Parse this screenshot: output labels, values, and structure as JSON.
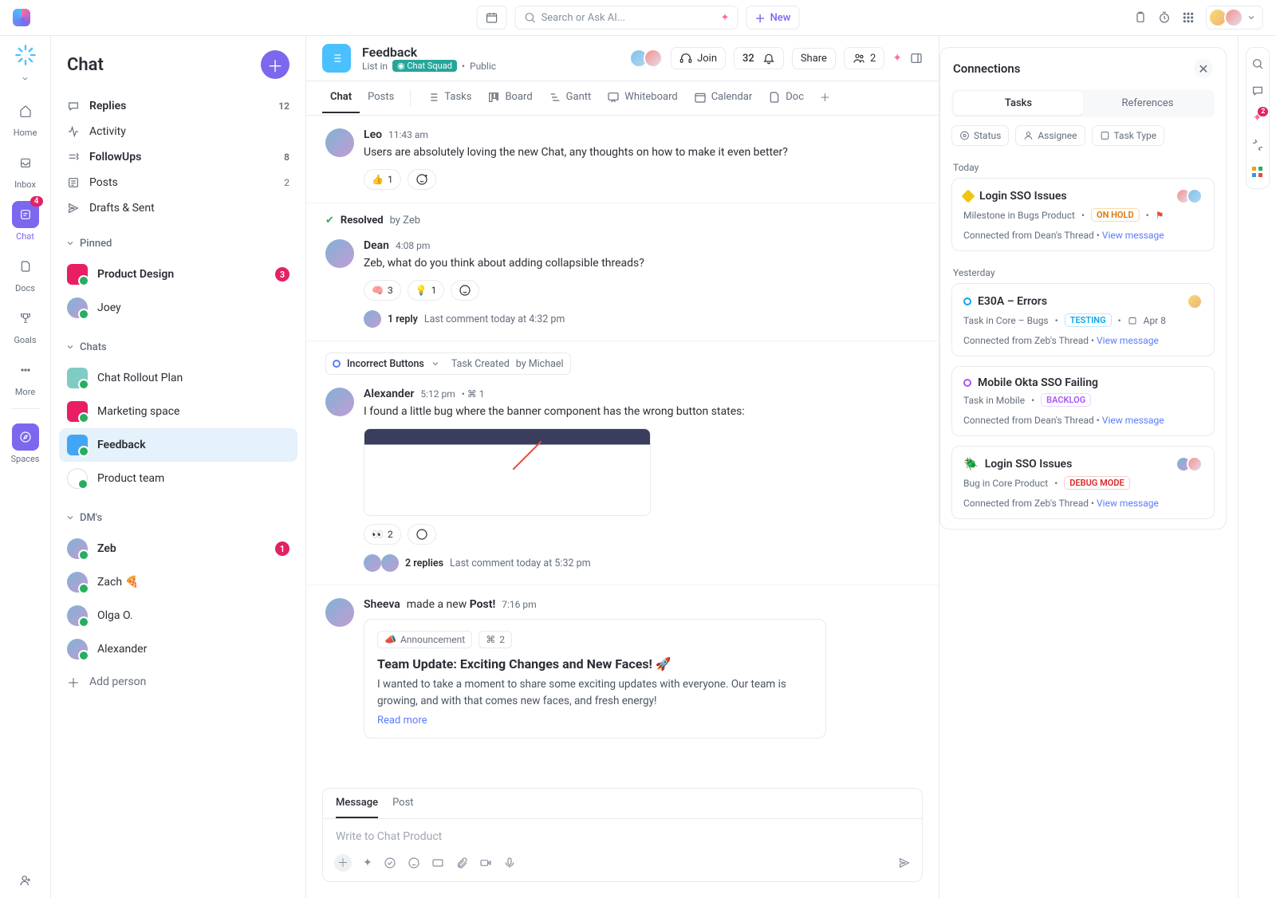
{
  "topbar": {
    "search_placeholder": "Search or Ask AI...",
    "new_label": "New"
  },
  "rail": {
    "home": "Home",
    "inbox": "Inbox",
    "chat": "Chat",
    "chat_badge": "4",
    "docs": "Docs",
    "goals": "Goals",
    "more": "More",
    "spaces": "Spaces"
  },
  "sidebar": {
    "title": "Chat",
    "nav": {
      "replies": {
        "label": "Replies",
        "count": "12"
      },
      "activity": {
        "label": "Activity"
      },
      "followups": {
        "label": "FollowUps",
        "count": "8"
      },
      "posts": {
        "label": "Posts",
        "count": "2"
      },
      "drafts": {
        "label": "Drafts & Sent"
      }
    },
    "pinned_label": "Pinned",
    "pinned": [
      {
        "label": "Product Design",
        "badge": "3"
      },
      {
        "label": "Joey"
      }
    ],
    "chats_label": "Chats",
    "chats": [
      {
        "label": "Chat Rollout Plan"
      },
      {
        "label": "Marketing space"
      },
      {
        "label": "Feedback",
        "selected": true
      },
      {
        "label": "Product team"
      }
    ],
    "dms_label": "DM's",
    "dms": [
      {
        "label": "Zeb",
        "badge": "1"
      },
      {
        "label": "Zach 🍕"
      },
      {
        "label": "Olga O."
      },
      {
        "label": "Alexander"
      }
    ],
    "add_person": "Add person"
  },
  "header": {
    "title": "Feedback",
    "list_in": "List in",
    "squad": "Chat Squad",
    "visibility": "Public",
    "join": "Join",
    "count": "32",
    "share": "Share",
    "people": "2"
  },
  "viewtabs": {
    "chat": "Chat",
    "posts": "Posts",
    "tasks": "Tasks",
    "board": "Board",
    "gantt": "Gantt",
    "whiteboard": "Whiteboard",
    "calendar": "Calendar",
    "doc": "Doc"
  },
  "feed": {
    "m1": {
      "author": "Leo",
      "time": "11:43 am",
      "text": "Users are absolutely loving the new Chat, any thoughts on how to make it even better?",
      "react_emoji": "👍",
      "react_count": "1"
    },
    "resolved": {
      "label": "Resolved",
      "by": "by Zeb"
    },
    "m2": {
      "author": "Dean",
      "time": "4:08 pm",
      "text": "Zeb, what do you think about adding collapsible threads?",
      "r1_emoji": "🧠",
      "r1_count": "3",
      "r2_emoji": "💡",
      "r2_count": "1",
      "reply_count": "1 reply",
      "reply_meta": "Last comment today at 4:32 pm"
    },
    "task": {
      "label": "Incorrect Buttons",
      "created": "Task Created",
      "by": "by Michael"
    },
    "m3": {
      "author": "Alexander",
      "time": "5:12 pm",
      "extra": "1",
      "text": "I found a little bug where the banner component has the wrong button states:",
      "react_emoji": "👀",
      "react_count": "2",
      "reply_count": "2 replies",
      "reply_meta": "Last comment today at 5:32 pm"
    },
    "post": {
      "author": "Sheeva",
      "verb": "made a new",
      "noun": "Post!",
      "time": "7:16 pm",
      "tag": "Announcement",
      "tag_count": "2",
      "title": "Team Update: Exciting Changes and New Faces! 🚀",
      "body": "I wanted to take a moment to share some exciting updates with everyone. Our team is growing, and with that comes new faces, and fresh energy!",
      "readmore": "Read more"
    }
  },
  "composer": {
    "tab_message": "Message",
    "tab_post": "Post",
    "placeholder": "Write to Chat Product"
  },
  "panel": {
    "title": "Connections",
    "tab_tasks": "Tasks",
    "tab_refs": "References",
    "f_status": "Status",
    "f_assignee": "Assignee",
    "f_type": "Task Type",
    "g_today": "Today",
    "g_yesterday": "Yesterday",
    "c1": {
      "title": "Login SSO Issues",
      "meta": "Milestone in Bugs Product",
      "status": "ON HOLD",
      "foot": "Connected from Dean's Thread",
      "view": "View message"
    },
    "c2": {
      "title": "E30A – Errors",
      "meta": "Task in Core – Bugs",
      "status": "TESTING",
      "date": "Apr 8",
      "foot": "Connected from Zeb's Thread",
      "view": "View message"
    },
    "c3": {
      "title": "Mobile Okta SSO Failing",
      "meta": "Task in Mobile",
      "status": "BACKLOG",
      "foot": "Connected from Dean's Thread",
      "view": "View message"
    },
    "c4": {
      "title": "Login SSO Issues",
      "meta": "Bug in Core Product",
      "status": "DEBUG MODE",
      "foot": "Connected from Zeb's Thread",
      "view": "View message"
    }
  },
  "rightrail": {
    "badge": "2"
  }
}
